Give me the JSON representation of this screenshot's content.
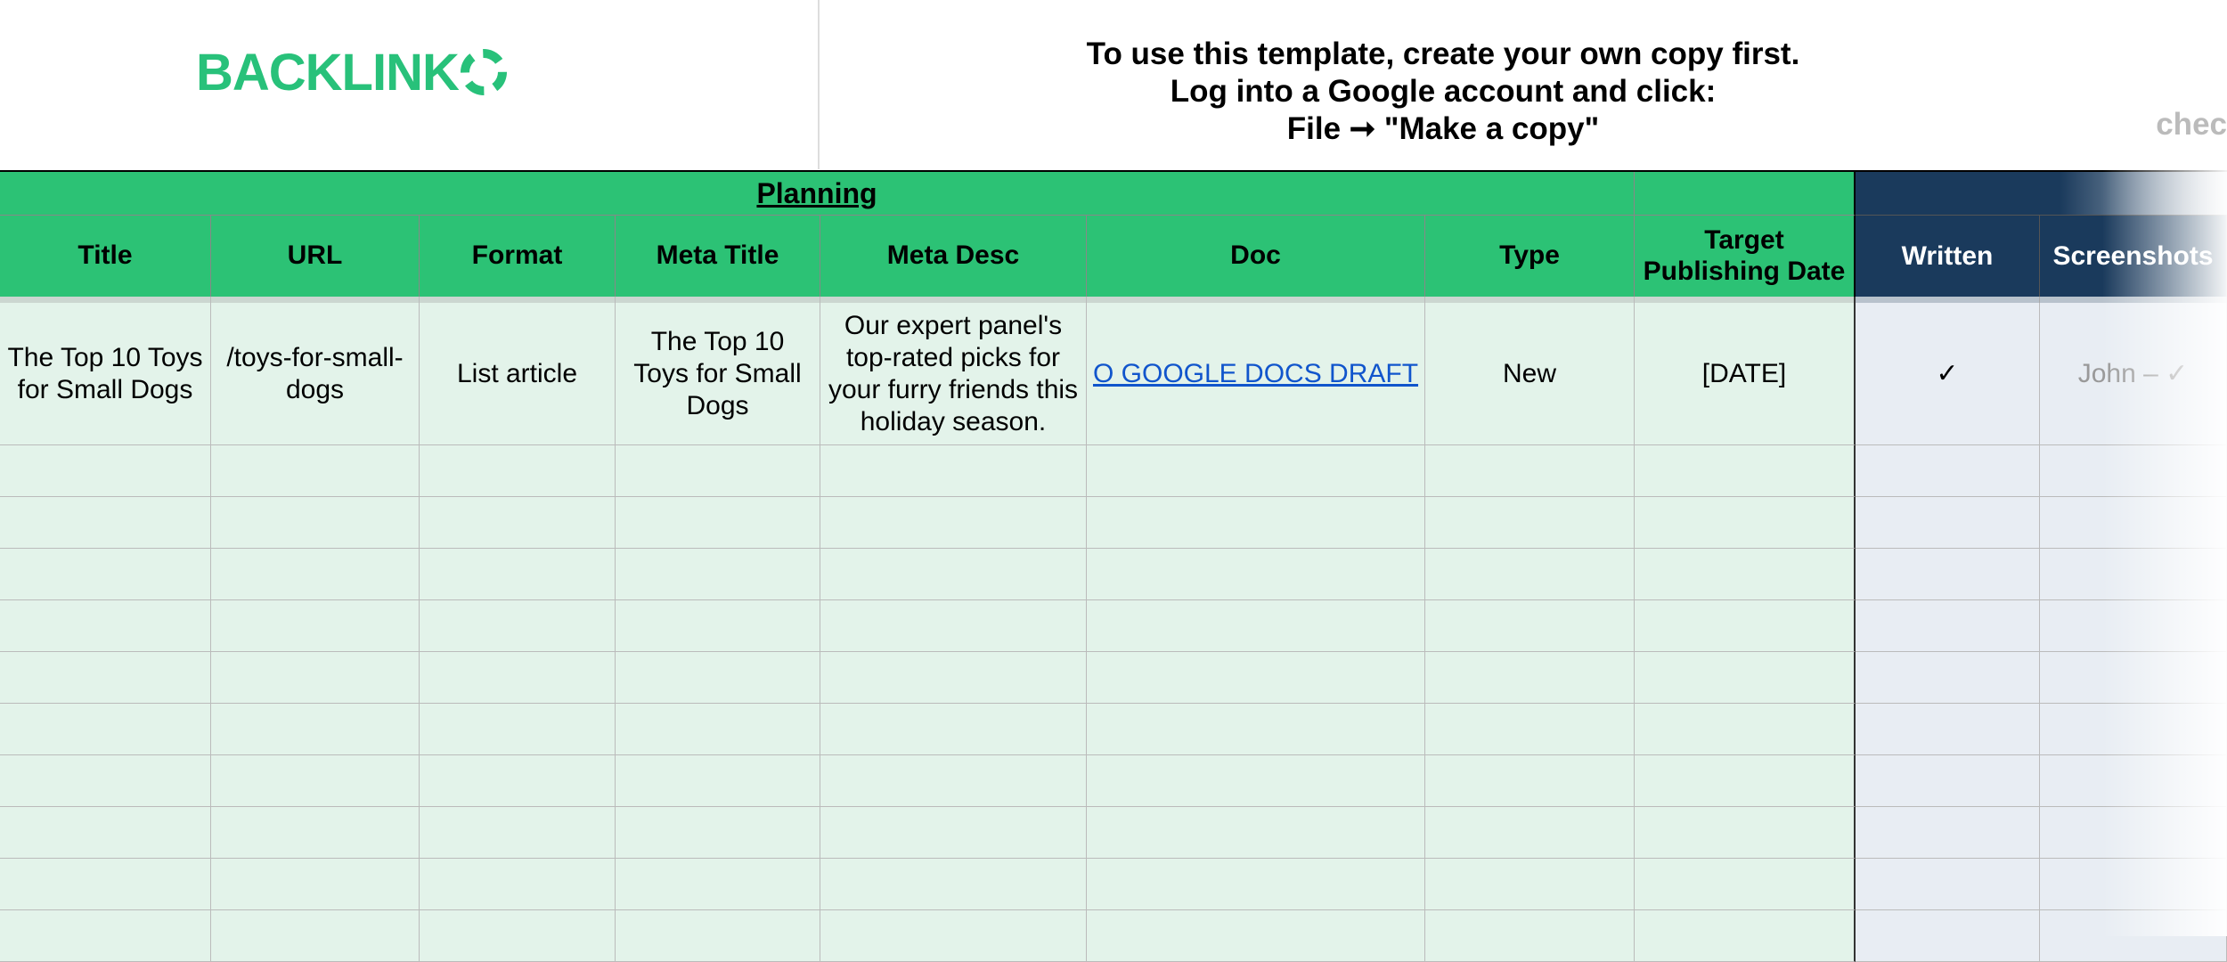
{
  "brand": "BACKLINK",
  "instructions": {
    "line1": "To use this template, create your own copy first.",
    "line2": "Log into a Google account and click:",
    "line3": "File ➞ \"Make a copy\""
  },
  "partial_text_right": "chec",
  "sections": {
    "planning": "Planning"
  },
  "headers": {
    "title": "Title",
    "url": "URL",
    "format": "Format",
    "meta_title": "Meta Title",
    "meta_desc": "Meta Desc",
    "doc": "Doc",
    "type": "Type",
    "target_date": "Target Publishing Date",
    "written": "Written",
    "screenshots": "Screenshots"
  },
  "rows": [
    {
      "title": "The Top 10 Toys for Small Dogs",
      "url": "/toys-for-small-dogs",
      "format": "List article",
      "meta_title": "The Top 10 Toys for Small Dogs",
      "meta_desc": "Our expert panel's top-rated picks for your furry friends this holiday season.",
      "doc": "O GOOGLE DOCS DRAFT",
      "type": "New",
      "target_date": "[DATE]",
      "written": "✓",
      "screenshots": "John – ✓"
    }
  ]
}
